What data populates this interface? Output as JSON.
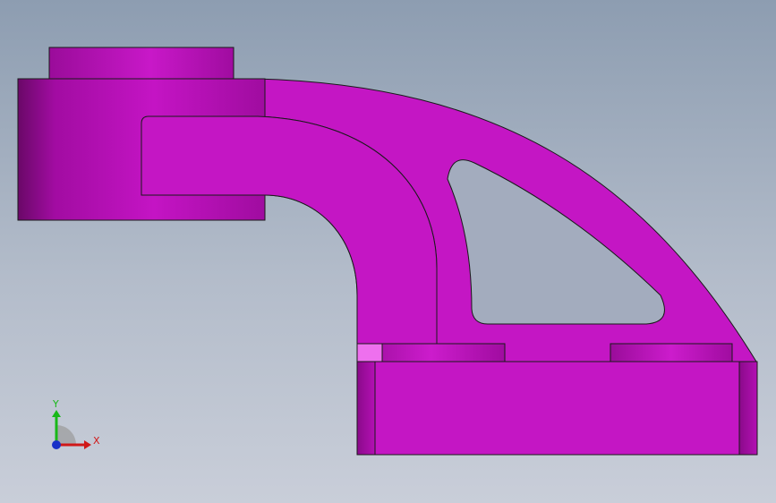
{
  "viewport": {
    "background_top": "#8d9db1",
    "background_bottom": "#c9ced9"
  },
  "part": {
    "color": "#c416c4",
    "shade_color": "#9a0c9a",
    "highlight_color": "#f080f0",
    "edge_color": "#1a1a1a"
  },
  "triad": {
    "x_label": "X",
    "y_label": "Y",
    "x_color": "#d01818",
    "y_color": "#18b818",
    "z_color": "#1830c8"
  }
}
